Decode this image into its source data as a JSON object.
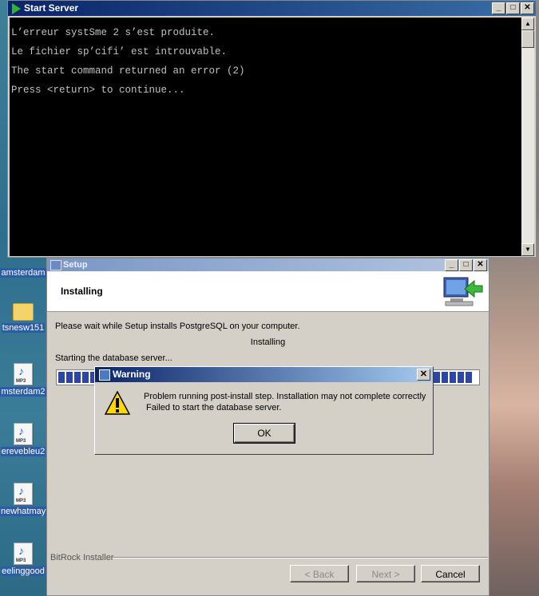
{
  "desktop": {
    "icons": [
      {
        "label": "amsterdam"
      },
      {
        "label": "tsnesw151"
      },
      {
        "label": "msterdam2"
      },
      {
        "label": "ereveblеu2"
      },
      {
        "label": "newhatmay"
      },
      {
        "label": "eelinggood"
      }
    ],
    "mp3_text": "MP3"
  },
  "console": {
    "title": "Start Server",
    "lines": [
      "L’erreur systSme 2 s’est produite.",
      "Le fichier sp’cifi’ est introuvable.",
      "The start command returned an error (2)",
      "Press <return> to continue..."
    ]
  },
  "setup": {
    "title": "Setup",
    "heading": "Installing",
    "description": "Please wait while Setup installs PostgreSQL on your computer.",
    "status_center": "Installing",
    "status_detail": "Starting the database server...",
    "brand": "BitRock Installer",
    "back_label": "< Back",
    "next_label": "Next >",
    "cancel_label": "Cancel"
  },
  "warning": {
    "title": "Warning",
    "message_line1": "Problem running post-install step. Installation may not complete correctly",
    "message_line2": " Failed to start the database server.",
    "ok_label": "OK"
  },
  "colors": {
    "active_title": "#0a246a",
    "progress": "#2b46a8",
    "console_bg": "#000000"
  }
}
